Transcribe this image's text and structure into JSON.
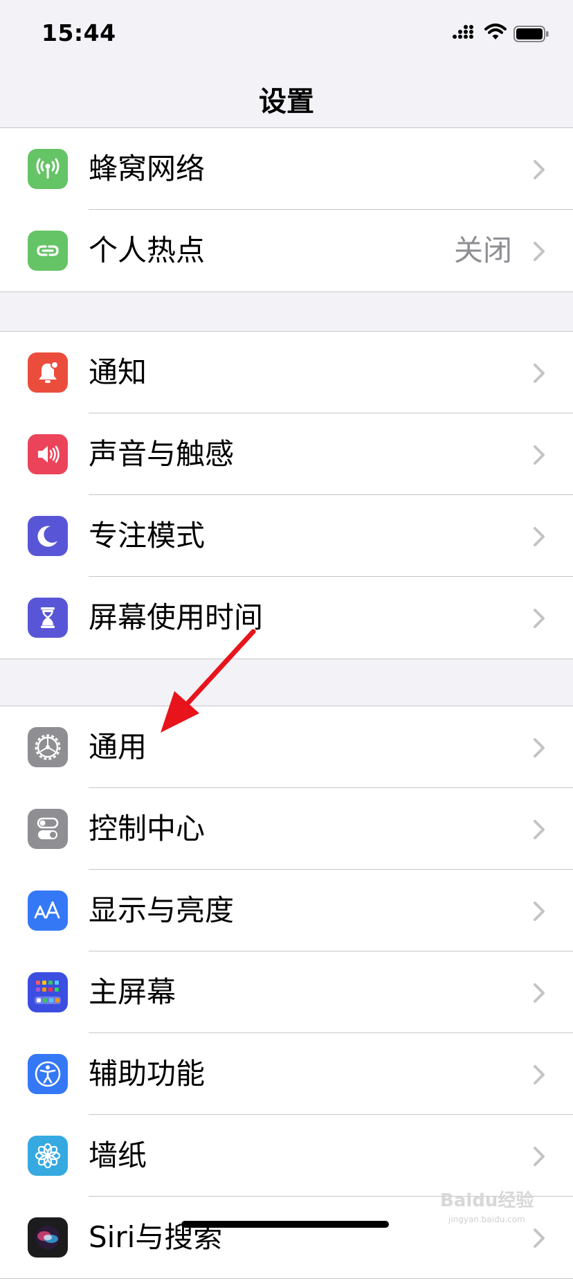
{
  "status_bar": {
    "time": "15:44"
  },
  "nav": {
    "title": "设置"
  },
  "groups": [
    {
      "items": [
        {
          "label": "蜂窝网络",
          "icon": "cellular-antenna-icon",
          "color": "#65c466"
        },
        {
          "label": "个人热点",
          "icon": "personal-hotspot-icon",
          "color": "#65c466",
          "value": "关闭"
        }
      ]
    },
    {
      "items": [
        {
          "label": "通知",
          "icon": "notification-bell-icon",
          "color": "#eb4d3d"
        },
        {
          "label": "声音与触感",
          "icon": "speaker-icon",
          "color": "#eb445a"
        },
        {
          "label": "专注模式",
          "icon": "moon-icon",
          "color": "#5856d6"
        },
        {
          "label": "屏幕使用时间",
          "icon": "hourglass-icon",
          "color": "#5856d6"
        }
      ]
    },
    {
      "items": [
        {
          "label": "通用",
          "icon": "gear-icon",
          "color": "#8e8e93"
        },
        {
          "label": "控制中心",
          "icon": "toggle-switches-icon",
          "color": "#8e8e93"
        },
        {
          "label": "显示与亮度",
          "icon": "text-size-aa-icon",
          "color": "#3478f6"
        },
        {
          "label": "主屏幕",
          "icon": "home-screen-grid-icon",
          "color": "#3b4ee0"
        },
        {
          "label": "辅助功能",
          "icon": "accessibility-figure-icon",
          "color": "#3478f6"
        },
        {
          "label": "墙纸",
          "icon": "flower-icon",
          "color": "#36a9e1"
        },
        {
          "label": "Siri与搜索",
          "icon": "siri-icon",
          "color": "#1c1c1e"
        }
      ]
    }
  ],
  "annotation": {
    "arrow_color": "#e8141b"
  },
  "watermark": {
    "text": "Baidu经验",
    "sub": "jingyan.baidu.com"
  }
}
